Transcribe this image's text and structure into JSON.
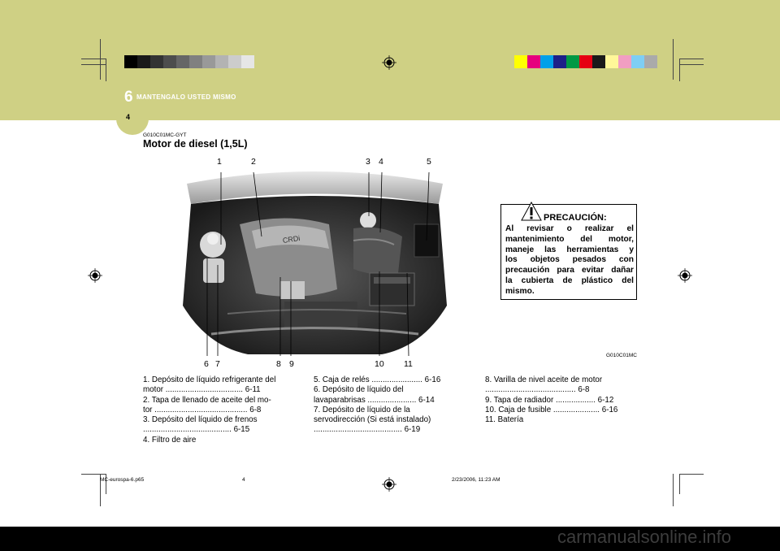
{
  "header": {
    "chapter_number": "6",
    "chapter_title": "MANTENGALO USTED MISMO",
    "page_number": "4",
    "band_color": "#cfd084"
  },
  "section": {
    "code": "G010C01MC-GYT",
    "title": "Motor de diesel (1,5L)"
  },
  "figure": {
    "code": "G010C01MC",
    "top_labels": [
      "1",
      "2",
      "3",
      "4",
      "5"
    ],
    "bottom_labels": [
      "6",
      "7",
      "8",
      "9",
      "10",
      "11"
    ]
  },
  "caution": {
    "title": "PRECAUCIÓN:",
    "lines": [
      "Al revisar o realizar el",
      "mantenimiento del motor,",
      "maneje las herramientas y",
      "los objetos pesados con",
      "precaución para evitar dañar",
      "la cubierta de plástico del",
      "mismo."
    ]
  },
  "list_col1": [
    "1.  Depósito de líquido refrigerante del",
    "      motor ................................... 6-11",
    "2.  Tapa de llenado de aceite del mo-",
    "      tor .......................................... 6-8",
    "3.  Depósito del líquido de frenos",
    "           ........................................ 6-15",
    "4.  Filtro de aire"
  ],
  "list_col2": [
    "5.  Caja de relés ....................... 6-16",
    "6.  Depósito   de   líquido   del",
    "      lavaparabrisas ...................... 6-14",
    "7.  Depósito   de   líquido   de   la",
    "      servodirección (Si está instalado)",
    "           ........................................ 6-19"
  ],
  "list_col3": [
    "8.  Varilla de nivel aceite de motor",
    "           ......................................... 6-8",
    "9.  Tapa de radiador .................. 6-12",
    "10. Caja de fusible ..................... 6-16",
    "11. Batería"
  ],
  "footer": {
    "file": "MC-eurospa-6.p65",
    "page": "4",
    "date": "2/23/2006, 11:23 AM"
  },
  "watermark": "carmanualsonline.info",
  "colorbar_gray": [
    "#000000",
    "#1a1a1a",
    "#333333",
    "#4d4d4d",
    "#666666",
    "#808080",
    "#999999",
    "#b3b3b3",
    "#cccccc",
    "#e6e6e6"
  ],
  "colorbar_color": [
    "#ffff00",
    "#e6007e",
    "#00a0e9",
    "#1d2088",
    "#009944",
    "#e60012",
    "#1a1a1a",
    "#fff799",
    "#f19ec2",
    "#7ecef4",
    "#aaaaaa"
  ]
}
